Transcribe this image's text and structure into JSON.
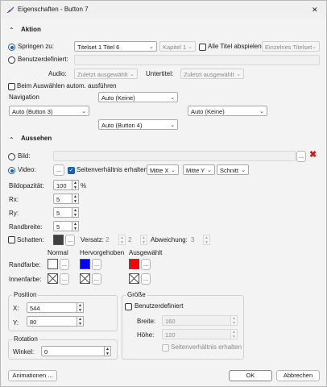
{
  "window": {
    "title": "Eigenschaften - Button 7",
    "close_glyph": "✕"
  },
  "action": {
    "header": "Aktion",
    "jump_label": "Springen zu:",
    "titleset_value": "Titelset 1 Titel 6",
    "chapter_value": "Kapitel 1",
    "play_all_label": "Alle Titel abspielen",
    "single_titleset_value": "Einzelnes Titelset",
    "custom_label": "Benutzerdefiniert:",
    "audio_label": "Audio:",
    "audio_value": "Zuletzt ausgewählt",
    "subtitle_label": "Untertitel:",
    "subtitle_value": "Zuletzt ausgewählt",
    "auto_run_label": "Beim Auswählen autom. ausführen",
    "navigation_label": "Navigation",
    "nav_up": "Auto (Keine)",
    "nav_left": "Auto (Button 3)",
    "nav_right": "Auto (Keine)",
    "nav_down": "Auto (Button 4)"
  },
  "appearance": {
    "header": "Aussehen",
    "image_label": "Bild:",
    "browse": "...",
    "video_label": "Video:",
    "aspect_label": "Seitenverhältnis erhalten",
    "pos_x_value": "Mitte X",
    "pos_y_value": "Mitte Y",
    "cut_value": "Schnitt",
    "opacity_label": "Bildopazität:",
    "opacity_value": "100",
    "opacity_unit": "%",
    "rx_label": "Rx:",
    "rx_value": "5",
    "ry_label": "Ry:",
    "ry_value": "5",
    "border_label": "Randbreite:",
    "border_value": "5",
    "shadow_label": "Schatten:",
    "offset_label": "Versatz:",
    "offset_x": "2",
    "offset_y": "2",
    "deviation_label": "Abweichung:",
    "deviation_value": "3",
    "col_normal": "Normal",
    "col_highlighted": "Hervorgehoben",
    "col_selected": "Ausgewählt",
    "border_color_label": "Randfarbe:",
    "fill_color_label": "Innenfarbe:",
    "colors": {
      "normal": "#ffffff",
      "highlighted": "#0000ff",
      "selected": "#ff0000",
      "shadow": "#404040"
    }
  },
  "position": {
    "title": "Position",
    "x_label": "X:",
    "x_value": "544",
    "y_label": "Y:",
    "y_value": "80"
  },
  "size": {
    "title": "Größe",
    "custom_label": "Benutzerdefiniert",
    "width_label": "Breite:",
    "width_value": "160",
    "height_label": "Höhe:",
    "height_value": "120",
    "keep_aspect_label": "Seitenverhältnis erhalten"
  },
  "rotation": {
    "title": "Rotation",
    "angle_label": "Winkel:",
    "angle_value": "0"
  },
  "footer": {
    "animations": "Animationen ...",
    "ok": "OK",
    "cancel": "Abbrechen"
  }
}
